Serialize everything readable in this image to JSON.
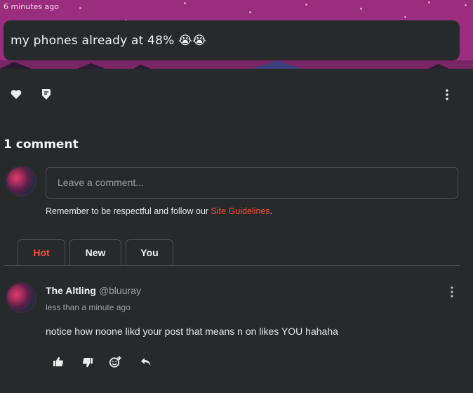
{
  "post": {
    "timestamp": "6 minutes ago",
    "caption": "my phones already at 48% 😭😭",
    "actions": {
      "like_icon": "heart-icon",
      "tag_icon": "tag-icon",
      "more_icon": "more-vertical-icon"
    }
  },
  "comments": {
    "count_label": "1 comment",
    "input_placeholder": "Leave a comment...",
    "guidelines_text": "Remember to be respectful and follow our ",
    "guidelines_link": "Site Guidelines",
    "guidelines_end": ".",
    "tabs": [
      {
        "label": "Hot",
        "active": true
      },
      {
        "label": "New",
        "active": false
      },
      {
        "label": "You",
        "active": false
      }
    ],
    "items": [
      {
        "author": "The Altling",
        "handle": "@bluuray",
        "time": "less than a minute ago",
        "text": "notice how noone likd your post that means n on likes YOU hahaha",
        "actions": [
          "thumbs-up-icon",
          "thumbs-down-icon",
          "add-reaction-icon",
          "reply-icon"
        ]
      }
    ]
  },
  "colors": {
    "accent": "#ff4b3a",
    "banner": "#9b2d7e",
    "background": "#272a2b"
  }
}
